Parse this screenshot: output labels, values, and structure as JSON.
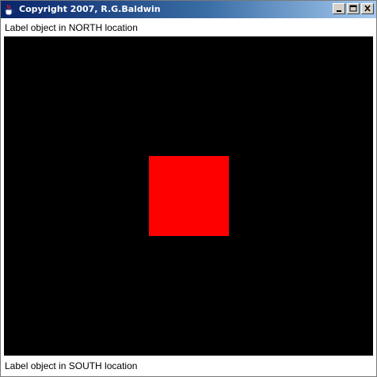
{
  "window": {
    "title": "Copyright 2007, R.G.Baldwin",
    "app_icon": "java-coffee-cup-icon",
    "controls": [
      "minimize-icon",
      "maximize-icon",
      "close-icon"
    ]
  },
  "labels": {
    "north": "Label object in NORTH location",
    "south": "Label object in SOUTH location"
  },
  "canvas": {
    "background_color": "#000000",
    "square_color": "#ff0000"
  },
  "colors": {
    "titlebar_start": "#0a246a",
    "titlebar_end": "#a6caf0",
    "frame_face": "#d4d0c8"
  }
}
